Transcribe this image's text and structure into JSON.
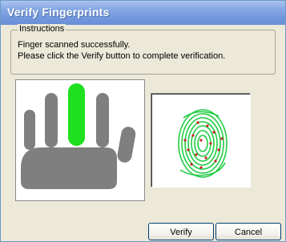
{
  "window": {
    "title": "Verify Fingerprints"
  },
  "instructions": {
    "legend": "Instructions",
    "lines": [
      "Finger scanned successfully.",
      "Please click the Verify button to complete verification."
    ]
  },
  "hand": {
    "scanned_finger": "middle",
    "colors": {
      "finger": "#7f7f7f",
      "highlight": "#1ee01e"
    }
  },
  "fingerprint": {
    "colors": {
      "ridges": "#22cc44",
      "minutiae": "#cc2222"
    }
  },
  "buttons": {
    "verify_label": "Verify",
    "cancel_label": "Cancel"
  }
}
